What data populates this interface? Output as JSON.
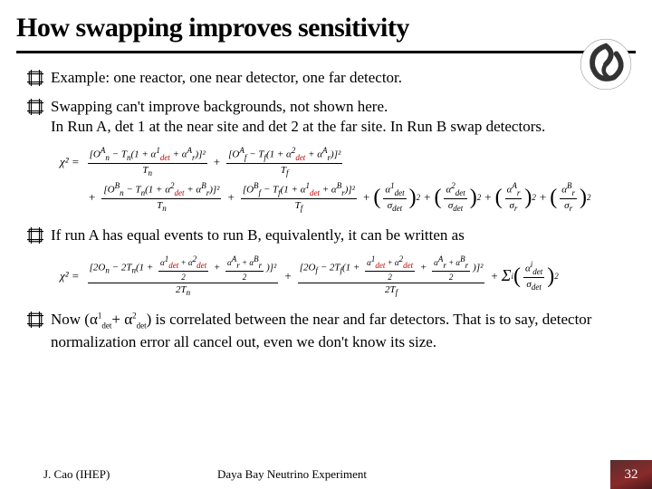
{
  "title": "How swapping improves sensitivity",
  "bullets": {
    "b1": "Example: one reactor, one near detector, one far detector.",
    "b2": "Swapping can't improve backgrounds, not shown here.\nIn Run A, det 1 at the near site and det 2 at the far site. In Run B swap detectors.",
    "b3": "If run A has equal events to run B, equivalently, it can be written as",
    "b4_pre": "Now (α",
    "b4_s1": "1",
    "b4_d1": "det",
    "b4_mid": "+ α",
    "b4_s2": "2",
    "b4_d2": "det",
    "b4_post": ") is correlated between the near and far detectors. That is to say, detector normalization error all cancel out, even we don't know its size."
  },
  "formula1": {
    "chi": "χ",
    "eq": "²  =",
    "t1_num": "[O",
    "t1_numA": "A",
    "t1_numN": "n",
    "t1_mid": " − T",
    "t1_paren": "(1 + α",
    "t1_det": "det",
    "t1_ar": " + α",
    "t1_arA": "A",
    "t1_arR": "r",
    "t1_close": ")]²",
    "t1_den": "T",
    "plus": "+"
  },
  "formula2": {
    "chi": "χ",
    "eq": "²  =",
    "pre2O": "[2O",
    "minus2T": " − 2T",
    "one_plus": "(1 +",
    "half_frac_num": "α¹ + α²",
    "half_frac_den": "2",
    "ar_frac_num_A": "A",
    "ar_frac_num_B": "B",
    "ar_r": "r",
    "close_sq": ")]²",
    "den2T": "2T",
    "sigma_det": "σ",
    "alpha_i": "α",
    "det": "det",
    "i": "i"
  },
  "footer": {
    "left": "J. Cao (IHEP)",
    "center": "Daya Bay Neutrino Experiment",
    "page": "32"
  }
}
